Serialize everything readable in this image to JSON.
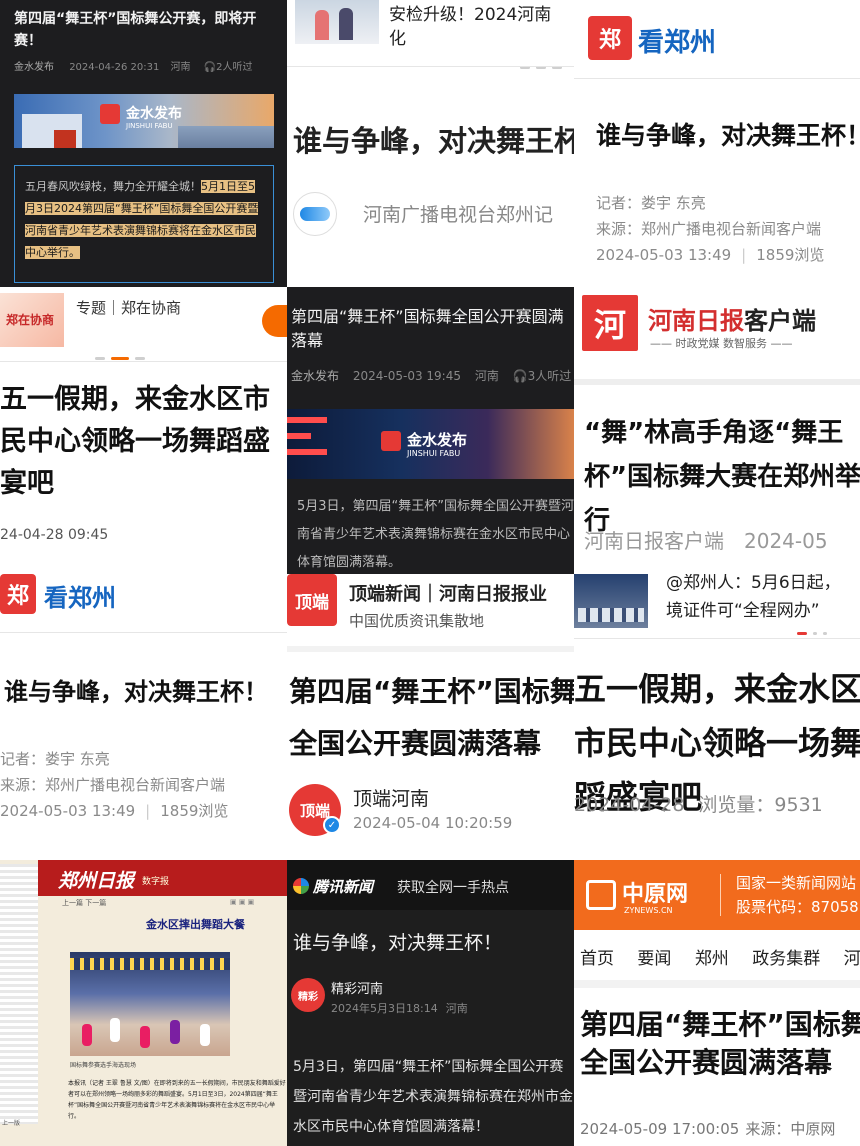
{
  "t1": {
    "title": "第四届“舞王杯”国标舞公开赛，即将开赛！",
    "author": "金水发布",
    "date": "2024-04-26 20:31",
    "place": "河南",
    "listen": "2人听过",
    "banner": "金水发布",
    "banner_sub": "JINSHUI FABU",
    "para_a": "五月春风吹绿枝，舞力全开耀全城！",
    "para_b": "5月1日至5月3日2024第四届“舞王杯”国标舞全国公开赛暨河南省青少年艺术表演舞锦标赛将在金水区市民中心举行。"
  },
  "t2": {
    "headline_top": "安检升级！2024河南",
    "headline_top2": "化",
    "title": "谁与争峰，对决舞王杯！",
    "source": "河南广播电视台郑州记"
  },
  "t3": {
    "logo_char": "郑",
    "logo_text": "看郑州",
    "title": "谁与争峰，对决舞王杯！",
    "reporter": "记者：娄宇 东亮",
    "source": "来源：郑州广播电视台新闻客户端",
    "date": "2024-05-03 13:49",
    "views": "1859浏览"
  },
  "t4": {
    "badge": "郑在协商",
    "topic": "专题｜郑在协商",
    "title": "五一假期，来金水区市民中心领略一场舞蹈盛宴吧",
    "date": "24-04-28 09:45"
  },
  "t5": {
    "title": "第四届“舞王杯”国标舞全国公开赛圆满落幕",
    "author": "金水发布",
    "date": "2024-05-03 19:45",
    "place": "河南",
    "listen": "3人听过",
    "banner": "金水发布",
    "banner_sub": "JINSHUI FABU",
    "para": "5月3日，第四届“舞王杯”国标舞全国公开赛暨河南省青少年艺术表演舞锦标赛在金水区市民中心体育馆圆满落幕。"
  },
  "t6": {
    "logo_char": "河",
    "logo_text": "河南日报",
    "logo_suffix": "客户端",
    "slogan": "—— 时政党媒  数智服务 ——",
    "title": "“舞”林高手角逐“舞王杯”国标舞大赛在郑州举行",
    "source": "河南日报客户端",
    "date": "2024-05"
  },
  "t7": {
    "logo_char": "郑",
    "logo_text": "看郑州",
    "title": "谁与争峰，对决舞王杯！",
    "reporter": "记者：娄宇 东亮",
    "source": "来源：郑州广播电视台新闻客户端",
    "date": "2024-05-03 13:49",
    "views": "1859浏览"
  },
  "t8": {
    "logo_char": "顶端",
    "header_title": "顶端新闻｜河南日报报业",
    "header_sub": "中国优质资讯集散地",
    "title": "第四届“舞王杯”国标舞全国公开赛圆满落幕",
    "author": "顶端河南",
    "date": "2024-05-04 10:20:59"
  },
  "t9": {
    "ticker": "@郑州人：5月6日起，",
    "ticker2": "境证件可“全程网办”",
    "title": "五一假期，来金水区市民中心领略一场舞蹈盛宴吧",
    "date": "2024-04-28",
    "views": "浏览量：9531"
  },
  "t10": {
    "paper": "郑州日报",
    "paper_sub": "数字报",
    "nav": "上一篇  下一篇",
    "headline": "金水区摔出舞蹈大餐",
    "caption": "国标舞参赛选手海选现场",
    "body": "本报讯（记者 王翠 鲁慧 文/图）在即将到来的五一长假期间，市民朋友和舞蹈爱好者可以在郑州领略一场绚丽多彩的舞蹈盛宴。5月1日至3日，2024第四届“舞王杯”国标舞全国公开赛暨河南省青少年艺术表演舞锦标赛将在金水区市民中心举行。",
    "footer": "上一版"
  },
  "t11": {
    "app": "腾讯新闻",
    "slogan": "获取全网一手热点",
    "title": "谁与争峰，对决舞王杯！",
    "author": "精彩河南",
    "date": "2024年5月3日18:14",
    "place": "河南",
    "para": "5月3日，第四届“舞王杯”国标舞全国公开赛暨河南省青少年艺术表演舞锦标赛在郑州市金水区市民中心体育馆圆满落幕！"
  },
  "t12": {
    "logo": "中原网",
    "logo_sub": "ZYNEWS.CN",
    "tag1": "国家一类新闻网站",
    "tag2": "股票代码：87058",
    "nav": [
      "首页",
      "要闻",
      "郑州",
      "政务集群",
      "河南"
    ],
    "title": "第四届“舞王杯”国标舞全国公开赛圆满落幕",
    "date": "2024-05-09 17:00:05",
    "source": "来源：中原网"
  },
  "colors": {
    "red": "#e53935",
    "gold": "#e7c083",
    "orange": "#f56a00",
    "dark": "#1d1d1f"
  }
}
